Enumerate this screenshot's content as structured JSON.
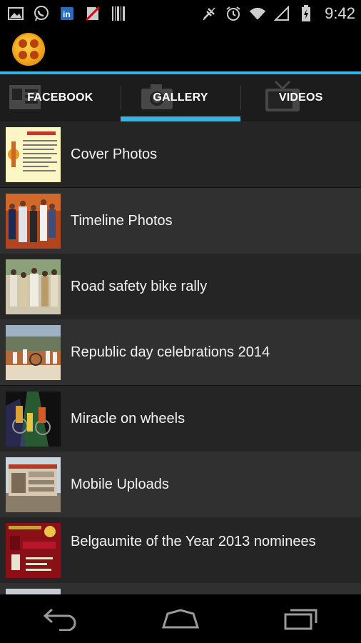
{
  "status_bar": {
    "time": "9:42",
    "left_icons": [
      "image-icon",
      "whatsapp-icon",
      "linkedin-icon",
      "no-sim-icon",
      "barcode-icon"
    ],
    "right_icons": [
      "signal-off-icon",
      "alarm-icon",
      "wifi-icon",
      "signal-icon",
      "battery-charging-icon"
    ]
  },
  "action_bar": {
    "logo_icon": "app-logo-icon"
  },
  "tabs": [
    {
      "label": "FACEBOOK",
      "icon": "profile-card-icon",
      "selected": false
    },
    {
      "label": "GALLERY",
      "icon": "camera-icon",
      "selected": true
    },
    {
      "label": "VIDEOS",
      "icon": "tv-icon",
      "selected": false
    }
  ],
  "albums": [
    {
      "title": "Cover Photos"
    },
    {
      "title": "Timeline Photos"
    },
    {
      "title": "Road safety bike rally"
    },
    {
      "title": "Republic day celebrations 2014"
    },
    {
      "title": "Miracle on wheels"
    },
    {
      "title": "Mobile Uploads"
    },
    {
      "title": "Belgaumite of the Year 2013 nominees"
    },
    {
      "title": ""
    }
  ],
  "nav_bar": {
    "buttons": [
      "back-icon",
      "home-icon",
      "recent-apps-icon"
    ]
  },
  "colors": {
    "accent": "#33b5e5",
    "row_dark": "#252525",
    "row_light": "#303030"
  }
}
